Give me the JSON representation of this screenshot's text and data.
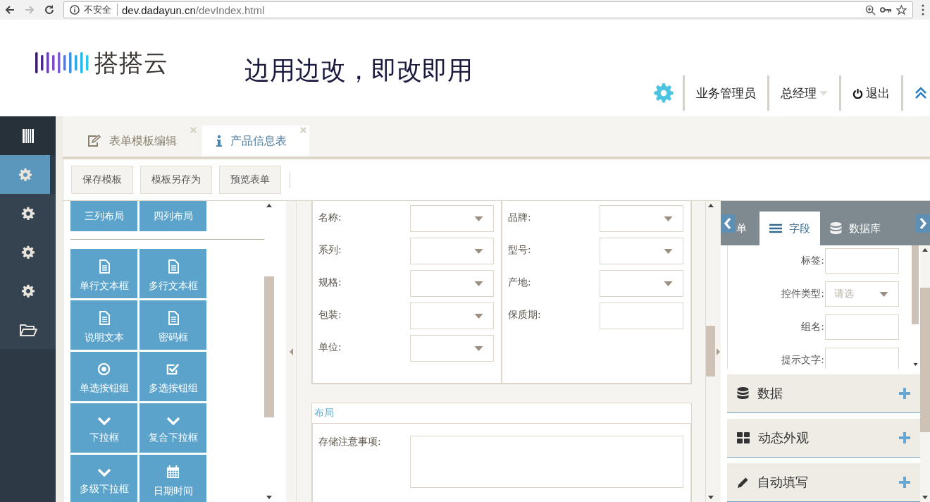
{
  "browser": {
    "security_label": "不安全",
    "url_host": "dev.dadayun.cn",
    "url_path": "/devIndex.html"
  },
  "header": {
    "logo_text": "搭搭云",
    "slogan": "边用边改，即改即用",
    "nav": [
      {
        "kind": "settings"
      },
      {
        "kind": "text",
        "label": "业务管理员"
      },
      {
        "kind": "dropdown",
        "label": "总经理"
      },
      {
        "kind": "logout",
        "label": "退出"
      },
      {
        "kind": "collapse"
      }
    ]
  },
  "sidebar": {
    "items": [
      {
        "kind": "bars",
        "selected": false
      },
      {
        "kind": "gear",
        "selected": true
      },
      {
        "kind": "gear",
        "selected": false
      },
      {
        "kind": "gear",
        "selected": false
      },
      {
        "kind": "gear",
        "selected": false
      },
      {
        "kind": "folder",
        "selected": false
      }
    ]
  },
  "tabs": [
    {
      "kind": "edit",
      "label": "表单模板编辑",
      "selected": false
    },
    {
      "kind": "info",
      "label": "产品信息表",
      "selected": true
    }
  ],
  "toolbar": [
    "保存模板",
    "模板另存为",
    "预览表单"
  ],
  "palette": [
    {
      "kind": "layout",
      "label": "三列布局"
    },
    {
      "kind": "layout",
      "label": "四列布局"
    },
    {
      "kind": "divider"
    },
    {
      "kind": "document",
      "label": "单行文本框"
    },
    {
      "kind": "document",
      "label": "多行文本框"
    },
    {
      "kind": "document",
      "label": "说明文本"
    },
    {
      "kind": "document",
      "label": "密码框"
    },
    {
      "kind": "radio",
      "label": "单选按钮组"
    },
    {
      "kind": "checkbox",
      "label": "多选按钮组"
    },
    {
      "kind": "chevron",
      "label": "下拉框"
    },
    {
      "kind": "chevron",
      "label": "复合下拉框"
    },
    {
      "kind": "chevron",
      "label": "多级下拉框"
    },
    {
      "kind": "calendar",
      "label": "日期时间"
    }
  ],
  "form": {
    "columns": [
      [
        {
          "label": "名称:",
          "kind": "select"
        },
        {
          "label": "系列:",
          "kind": "select"
        },
        {
          "label": "规格:",
          "kind": "select"
        },
        {
          "label": "包装:",
          "kind": "select"
        },
        {
          "label": "单位:",
          "kind": "select"
        }
      ],
      [
        {
          "label": "品牌:",
          "kind": "select"
        },
        {
          "label": "型号:",
          "kind": "select"
        },
        {
          "label": "产地:",
          "kind": "select"
        },
        {
          "label": "保质期:",
          "kind": "text"
        }
      ]
    ],
    "section": {
      "title": "布局",
      "fields": [
        {
          "label": "存储注意事项:",
          "kind": "textarea"
        }
      ]
    }
  },
  "right_panel": {
    "tabs": [
      {
        "kind": "form",
        "label": "单",
        "selected": false
      },
      {
        "kind": "list",
        "label": "字段",
        "selected": true
      },
      {
        "kind": "database",
        "label": "数据库",
        "selected": false
      }
    ],
    "properties": [
      {
        "label": "标签:",
        "kind": "text"
      },
      {
        "label": "控件类型:",
        "kind": "select",
        "placeholder": "请选"
      },
      {
        "label": "组名:",
        "kind": "text"
      },
      {
        "label": "提示文字:",
        "kind": "text"
      }
    ],
    "accordions": [
      {
        "kind": "database",
        "label": "数据",
        "expanded": false
      },
      {
        "kind": "grid",
        "label": "动态外观",
        "expanded": false
      },
      {
        "kind": "pencil",
        "label": "自动填写",
        "expanded": false
      }
    ]
  }
}
